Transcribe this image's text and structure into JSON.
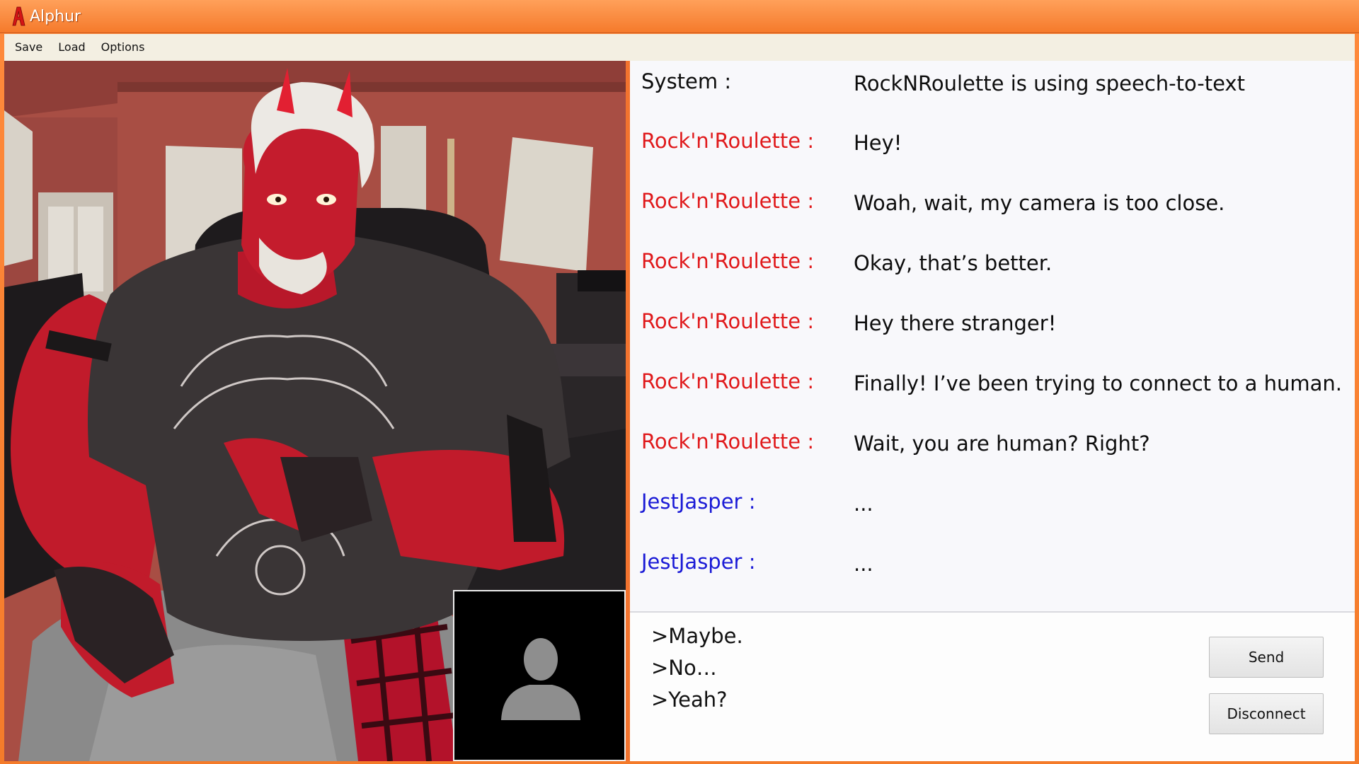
{
  "window": {
    "title": "Alphur"
  },
  "menu": {
    "items": [
      "Save",
      "Load",
      "Options"
    ]
  },
  "colors": {
    "titlebar": "#f57a2b",
    "speaker_rocknroulette": "#e0191b",
    "speaker_jestjasper": "#1a1ad6",
    "speaker_system": "#0d0d0d"
  },
  "scene": {
    "character": "Rock'n'Roulette",
    "self_camera_icon": "user-silhouette-icon"
  },
  "chat": {
    "messages": [
      {
        "speaker": "System :",
        "text": "RockNRoulette is using speech-to-text",
        "speaker_color": "#0d0d0d"
      },
      {
        "speaker": "Rock'n'Roulette :",
        "text": "Hey!",
        "speaker_color": "#e0191b"
      },
      {
        "speaker": "Rock'n'Roulette :",
        "text": "Woah, wait, my camera is too close.",
        "speaker_color": "#e0191b"
      },
      {
        "speaker": "Rock'n'Roulette :",
        "text": "Okay, that’s better.",
        "speaker_color": "#e0191b"
      },
      {
        "speaker": "Rock'n'Roulette :",
        "text": "Hey there stranger!",
        "speaker_color": "#e0191b"
      },
      {
        "speaker": "Rock'n'Roulette :",
        "text": "Finally! I’ve been trying to connect to a human.",
        "speaker_color": "#e0191b"
      },
      {
        "speaker": "Rock'n'Roulette :",
        "text": "Wait, you are human? Right?",
        "speaker_color": "#e0191b"
      },
      {
        "speaker": "JestJasper :",
        "text": "...",
        "speaker_color": "#1a1ad6"
      },
      {
        "speaker": "JestJasper :",
        "text": "...",
        "speaker_color": "#1a1ad6"
      }
    ]
  },
  "input": {
    "choices": [
      ">Maybe.",
      ">No…",
      ">Yeah?"
    ],
    "send_label": "Send",
    "disconnect_label": "Disconnect"
  }
}
